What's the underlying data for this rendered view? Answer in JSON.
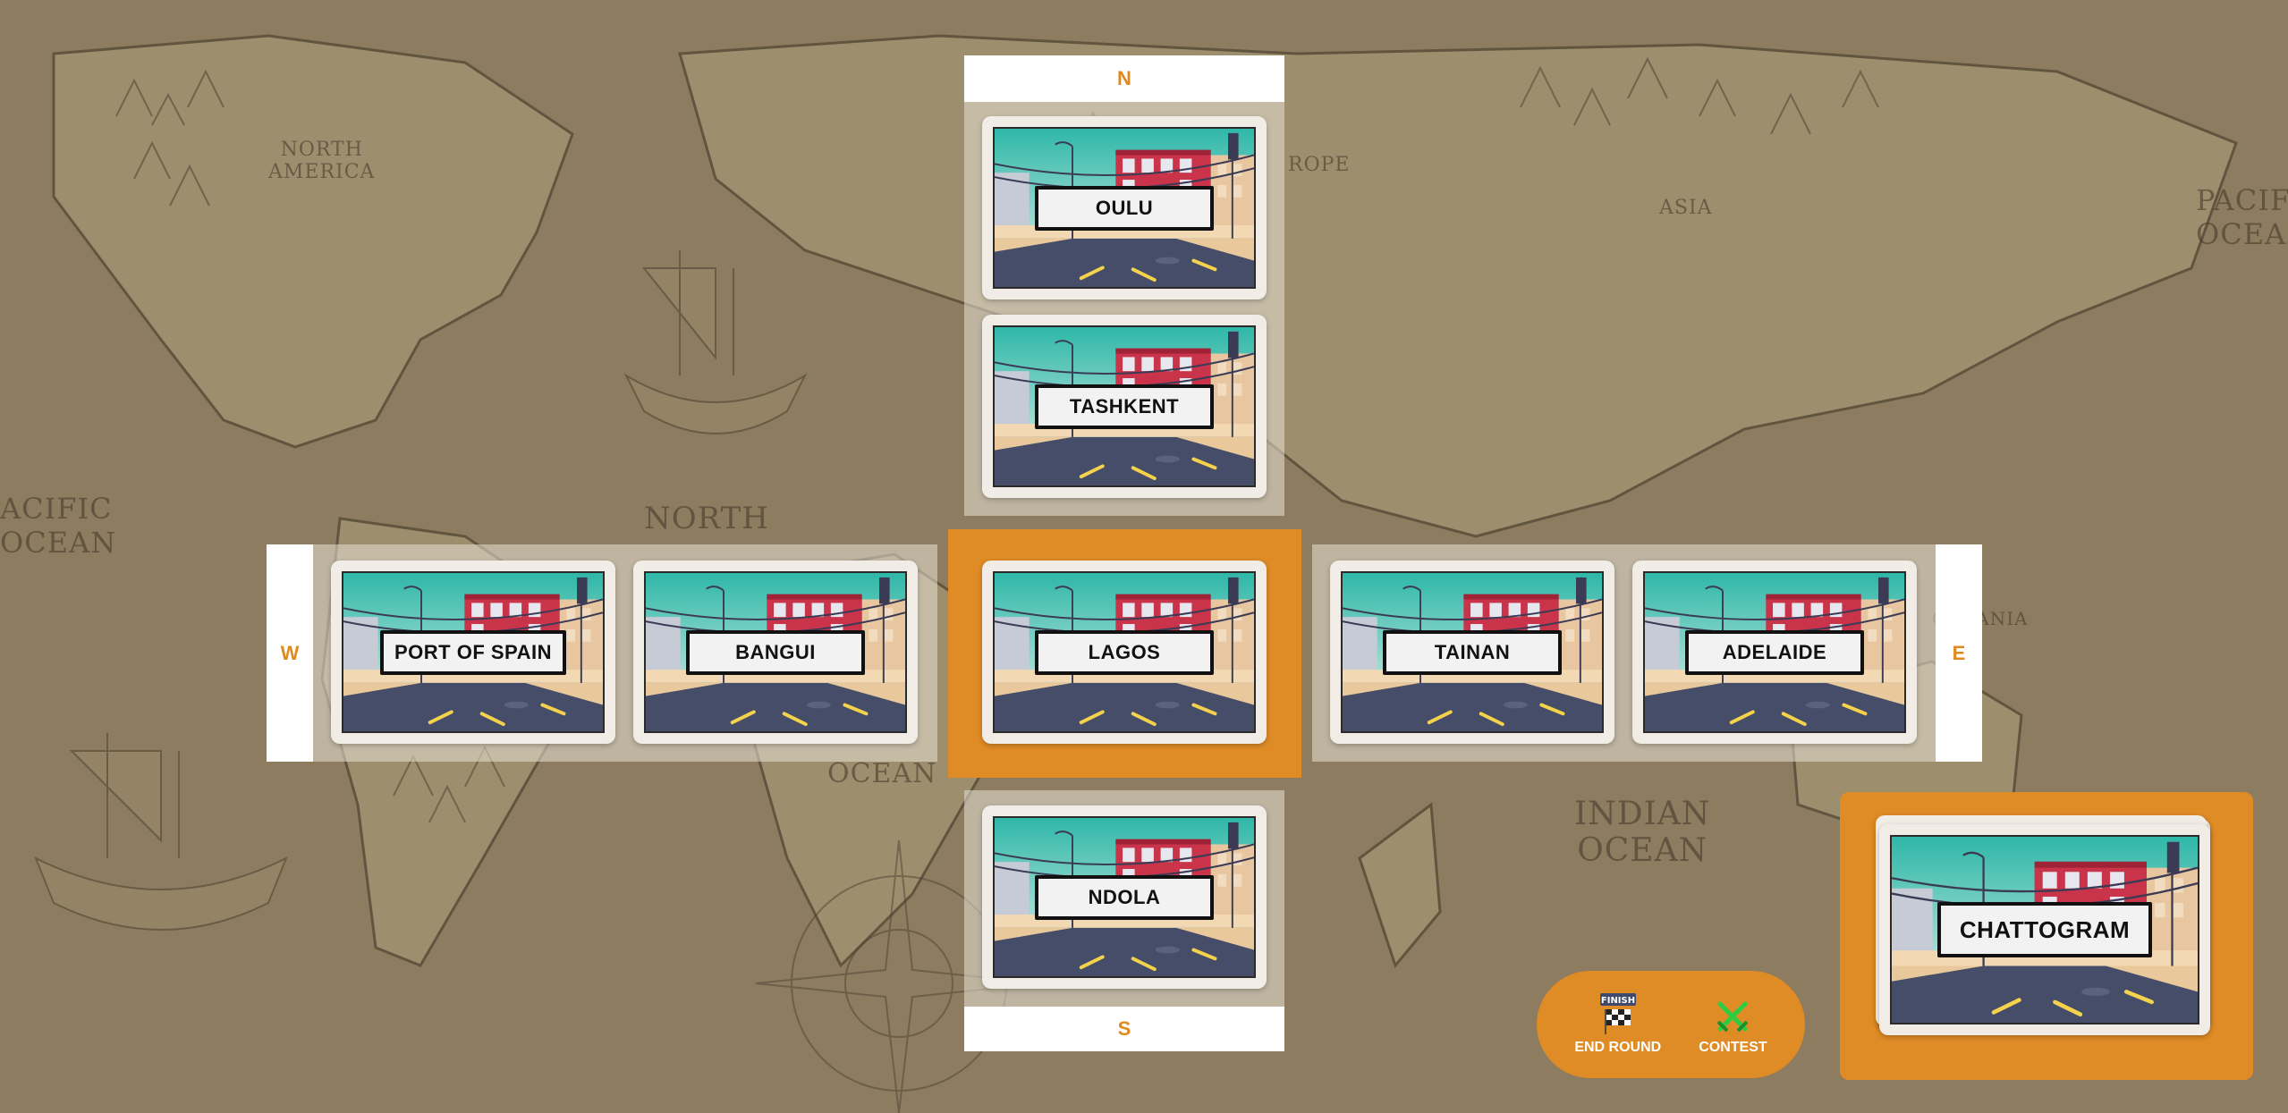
{
  "compass": {
    "north": "N",
    "south": "S",
    "west": "W",
    "east": "E"
  },
  "map_labels": {
    "north_america": "NORTH\nAMERICA",
    "asia": "ASIA",
    "europe": "ROPE",
    "pacific_left": "ACIFIC\nOCEAN",
    "pacific_right": "PACIF\nOCEA",
    "indian_ocean": "INDIAN\nOCEAN",
    "oceania": "OCEANIA",
    "north_atlantic": "NORTH",
    "ocean_mid": "OCEAN"
  },
  "cards": {
    "north": [
      "OULU",
      "TASHKENT"
    ],
    "center": "LAGOS",
    "west": [
      "PORT OF SPAIN",
      "BANGUI"
    ],
    "east": [
      "TAINAN",
      "ADELAIDE"
    ],
    "south": [
      "NDOLA"
    ]
  },
  "hand": {
    "card": "CHATTOGRAM"
  },
  "actions": {
    "end_round": {
      "label": "END ROUND",
      "badge": "FINISH"
    },
    "contest": {
      "label": "CONTEST"
    }
  },
  "colors": {
    "accent": "#df8b26",
    "compass_text": "#e08a1e",
    "contest_icon": "#2ecc40"
  },
  "icons": {
    "end_round": "checkered-flag-icon",
    "contest": "crossed-swords-icon"
  }
}
